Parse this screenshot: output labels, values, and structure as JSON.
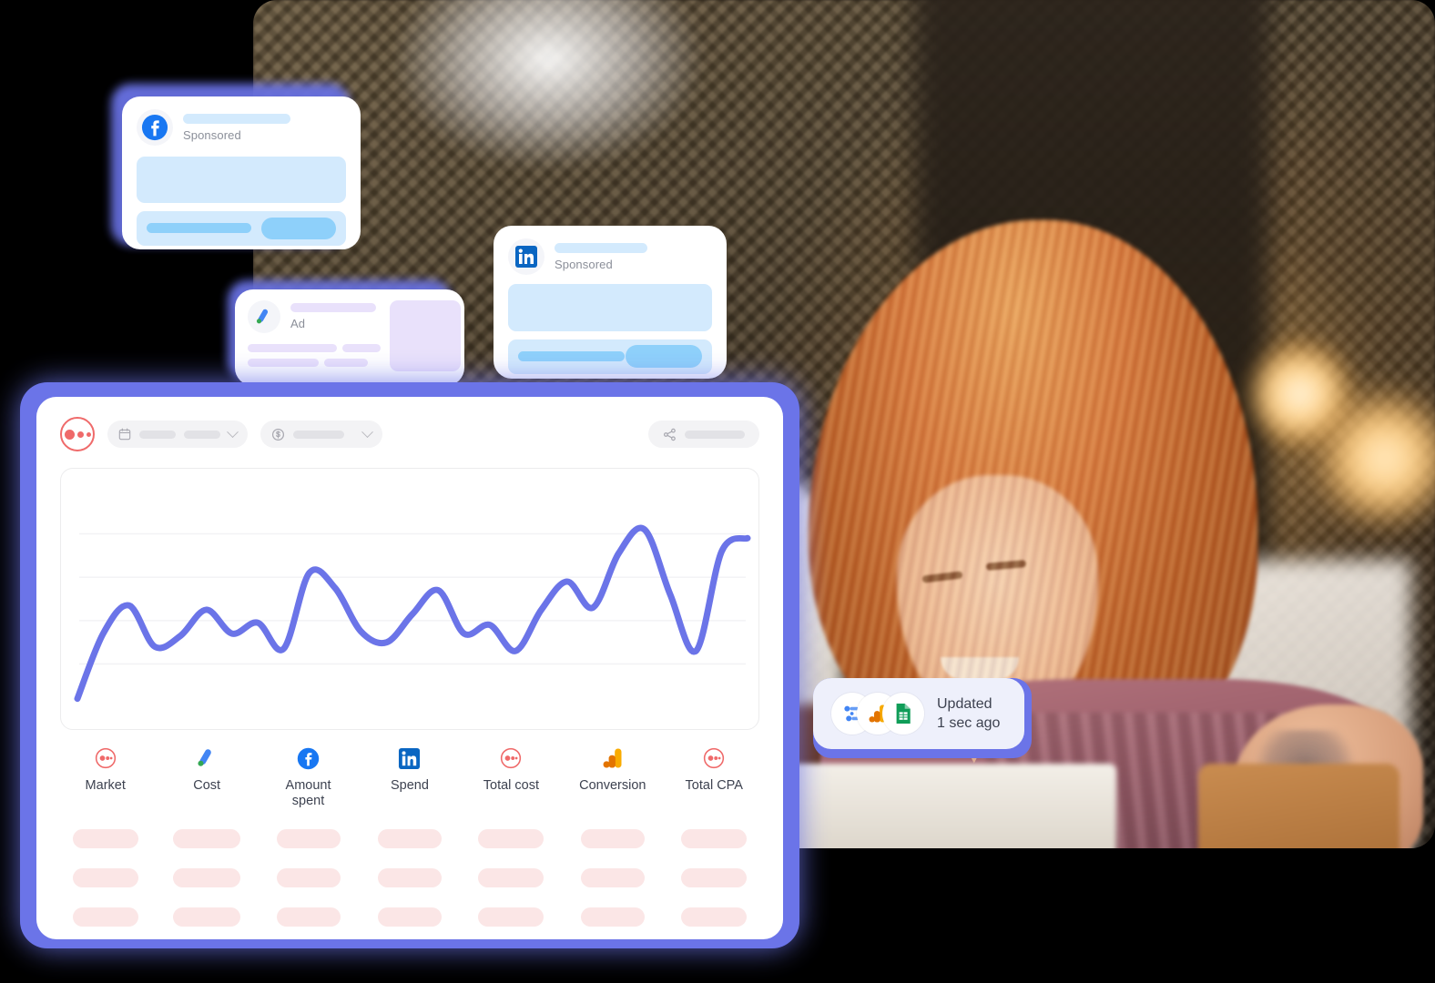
{
  "photo": {
    "alt": "Smiling woman with red hair working on a laptop in a cafe"
  },
  "ad_cards": [
    {
      "id": "facebook",
      "platform_icon": "facebook-icon",
      "label": "Sponsored",
      "accent": "#1877F2",
      "skeleton_color": "#d3eafd",
      "cta_color": "#8ed0fa"
    },
    {
      "id": "google-ads",
      "platform_icon": "google-ads-icon",
      "label": "Ad",
      "accent": "#4285F4",
      "skeleton_color": "#e9e1fb"
    },
    {
      "id": "linkedin",
      "platform_icon": "linkedin-icon",
      "label": "Sponsored",
      "accent": "#0A66C2",
      "skeleton_color": "#d3eafd",
      "cta_color": "#8ed0fa"
    }
  ],
  "dashboard": {
    "brand_logo": "supermetrics-logo",
    "brand_color": "#ef6a6a",
    "frame_color": "#6b74e8",
    "toolbar": {
      "date_filter": {
        "icon": "calendar-icon",
        "value": "",
        "chevron": "chevron-down-icon"
      },
      "currency_filter": {
        "icon": "dollar-circle-icon",
        "value": "",
        "chevron": "chevron-down-icon"
      },
      "share_button": {
        "icon": "share-icon",
        "label": ""
      }
    },
    "metrics": [
      {
        "label": "Market",
        "icon": "supermetrics-icon"
      },
      {
        "label": "Cost",
        "icon": "google-ads-icon"
      },
      {
        "label": "Amount spent",
        "icon": "facebook-icon"
      },
      {
        "label": "Spend",
        "icon": "linkedin-icon"
      },
      {
        "label": "Total cost",
        "icon": "supermetrics-icon"
      },
      {
        "label": "Conversion",
        "icon": "google-analytics-icon"
      },
      {
        "label": "Total CPA",
        "icon": "supermetrics-icon"
      }
    ],
    "table": {
      "row_count": 4,
      "column_count": 7,
      "cell_placeholder_color": "#fbe6e6"
    }
  },
  "update_badge": {
    "icons": [
      "looker-studio-icon",
      "google-analytics-icon",
      "google-sheets-icon"
    ],
    "line1": "Updated",
    "line2": "1 sec ago"
  },
  "chart_data": {
    "type": "line",
    "title": "",
    "xlabel": "",
    "ylabel": "",
    "grid": true,
    "legend": "none",
    "line_color": "#6b74e8",
    "ylim": [
      0,
      100
    ],
    "x": [
      0,
      1,
      2,
      3,
      4,
      5,
      6,
      7,
      8,
      9,
      10,
      11,
      12,
      13,
      14,
      15,
      16,
      17,
      18,
      19,
      20,
      21,
      22,
      23,
      24,
      25,
      26
    ],
    "values": [
      4,
      34,
      47,
      28,
      33,
      45,
      34,
      39,
      27,
      62,
      55,
      35,
      30,
      43,
      54,
      34,
      38,
      26,
      45,
      58,
      46,
      71,
      82,
      52,
      26,
      72,
      78
    ]
  }
}
